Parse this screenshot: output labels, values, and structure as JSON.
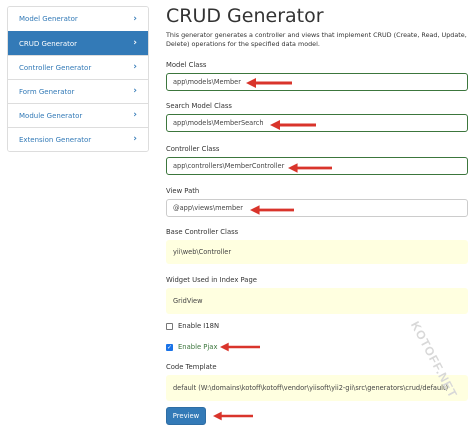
{
  "sidebar": {
    "items": [
      {
        "label": "Model Generator",
        "active": false
      },
      {
        "label": "CRUD Generator",
        "active": true
      },
      {
        "label": "Controller Generator",
        "active": false
      },
      {
        "label": "Form Generator",
        "active": false
      },
      {
        "label": "Module Generator",
        "active": false
      },
      {
        "label": "Extension Generator",
        "active": false
      }
    ],
    "chevron": "›"
  },
  "page": {
    "title": "CRUD Generator",
    "description": "This generator generates a controller and views that implement CRUD (Create, Read, Update, Delete) operations for the specified data model."
  },
  "form": {
    "model_class": {
      "label": "Model Class",
      "value": "app\\models\\Member"
    },
    "search_model_class": {
      "label": "Search Model Class",
      "value": "app\\models\\MemberSearch"
    },
    "controller_class": {
      "label": "Controller Class",
      "value": "app\\controllers\\MemberController"
    },
    "view_path": {
      "label": "View Path",
      "value": "@app\\views\\member"
    },
    "base_controller_class": {
      "label": "Base Controller Class",
      "value": "yii\\web\\Controller"
    },
    "index_widget": {
      "label": "Widget Used in Index Page",
      "value": "GridView"
    },
    "enable_i18n": {
      "label": "Enable I18N",
      "checked": false
    },
    "enable_pjax": {
      "label": "Enable Pjax",
      "checked": true
    },
    "code_template": {
      "label": "Code Template",
      "value": "default (W:\\domains\\kotoff\\kotoff\\vendor\\yiisoft\\yii2-gii\\src\\generators\\crud/default)"
    },
    "preview_label": "Preview"
  },
  "annotation": {
    "arrow_color": "#d9342b"
  },
  "watermark": "KOTOFF.NET"
}
